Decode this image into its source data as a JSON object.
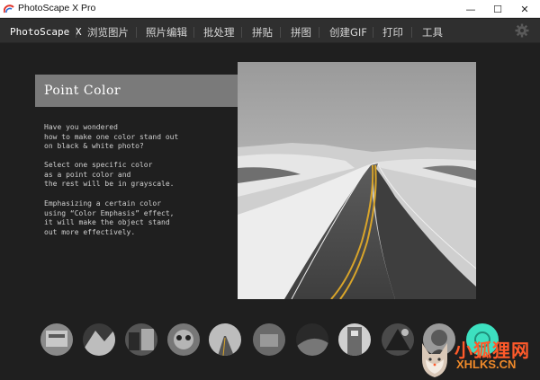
{
  "window": {
    "title": "PhotoScape X Pro",
    "controls": {
      "minimize": "—",
      "maximize": "☐",
      "close": "✕"
    }
  },
  "menu": {
    "brand": "PhotoScape X",
    "items": [
      "浏览图片",
      "照片编辑",
      "批处理",
      "拼贴",
      "拼图",
      "创建GIF",
      "打印",
      "工具"
    ]
  },
  "content": {
    "heading": "Point Color",
    "paragraphs": [
      "Have you wondered\nhow to make one color stand out\non black & white photo?",
      "Select one specific color\nas a point color and\nthe rest will be in grayscale.",
      "Emphasizing a certain color\nusing “Color Emphasis” effect,\nit will make the object stand\nout more effectively."
    ]
  },
  "thumbnails": {
    "count": 11,
    "active_index": 10
  },
  "watermark": {
    "cn": "小狐狸网",
    "en": "XHLKS.CN"
  },
  "colors": {
    "accent": "#3de0c0",
    "background": "#1f1f1f",
    "menubar": "#2f2f2f",
    "heading_box": "#7a7a7a",
    "watermark": "#ff5a2a"
  }
}
